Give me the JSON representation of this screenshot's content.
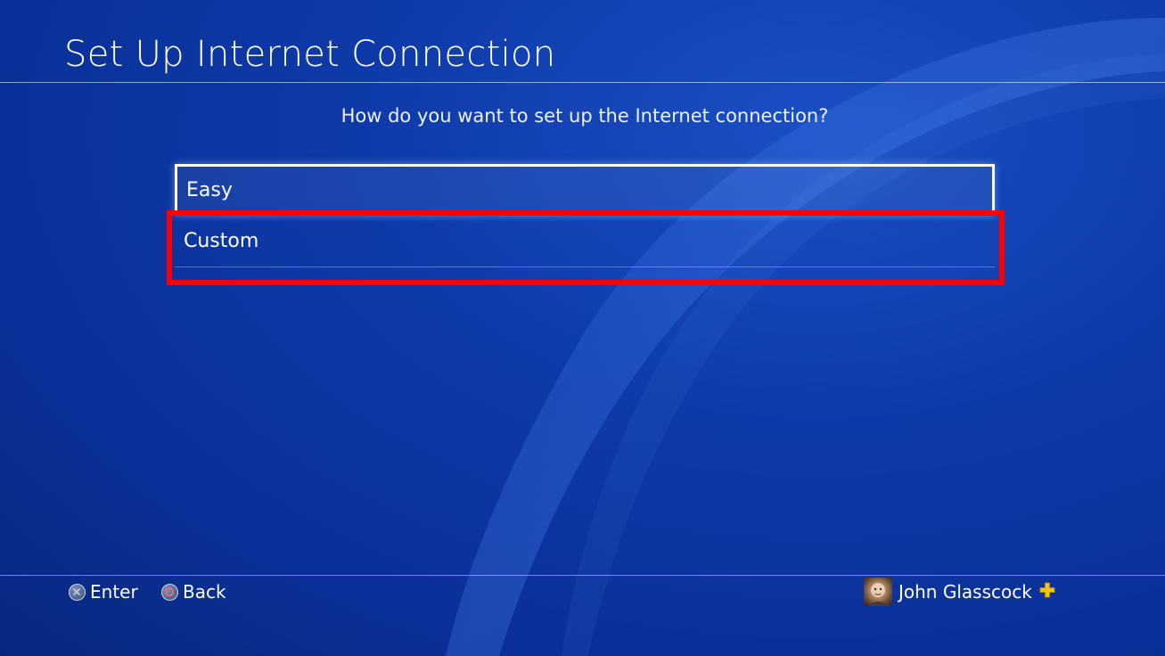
{
  "header": {
    "title": "Set Up Internet Connection"
  },
  "prompt": {
    "question": "How do you want to set up the Internet connection?"
  },
  "options": [
    {
      "label": "Easy",
      "selected": true
    },
    {
      "label": "Custom",
      "selected": false
    }
  ],
  "footer": {
    "enter_label": "Enter",
    "enter_icon": "cross-button-icon",
    "back_label": "Back",
    "back_icon": "circle-button-icon"
  },
  "user": {
    "name": "John Glasscock",
    "badge_icon": "ps-plus-icon"
  },
  "colors": {
    "background": "#0e3aa8",
    "highlight": "#ff0000",
    "plus_badge": "#f5c400"
  }
}
